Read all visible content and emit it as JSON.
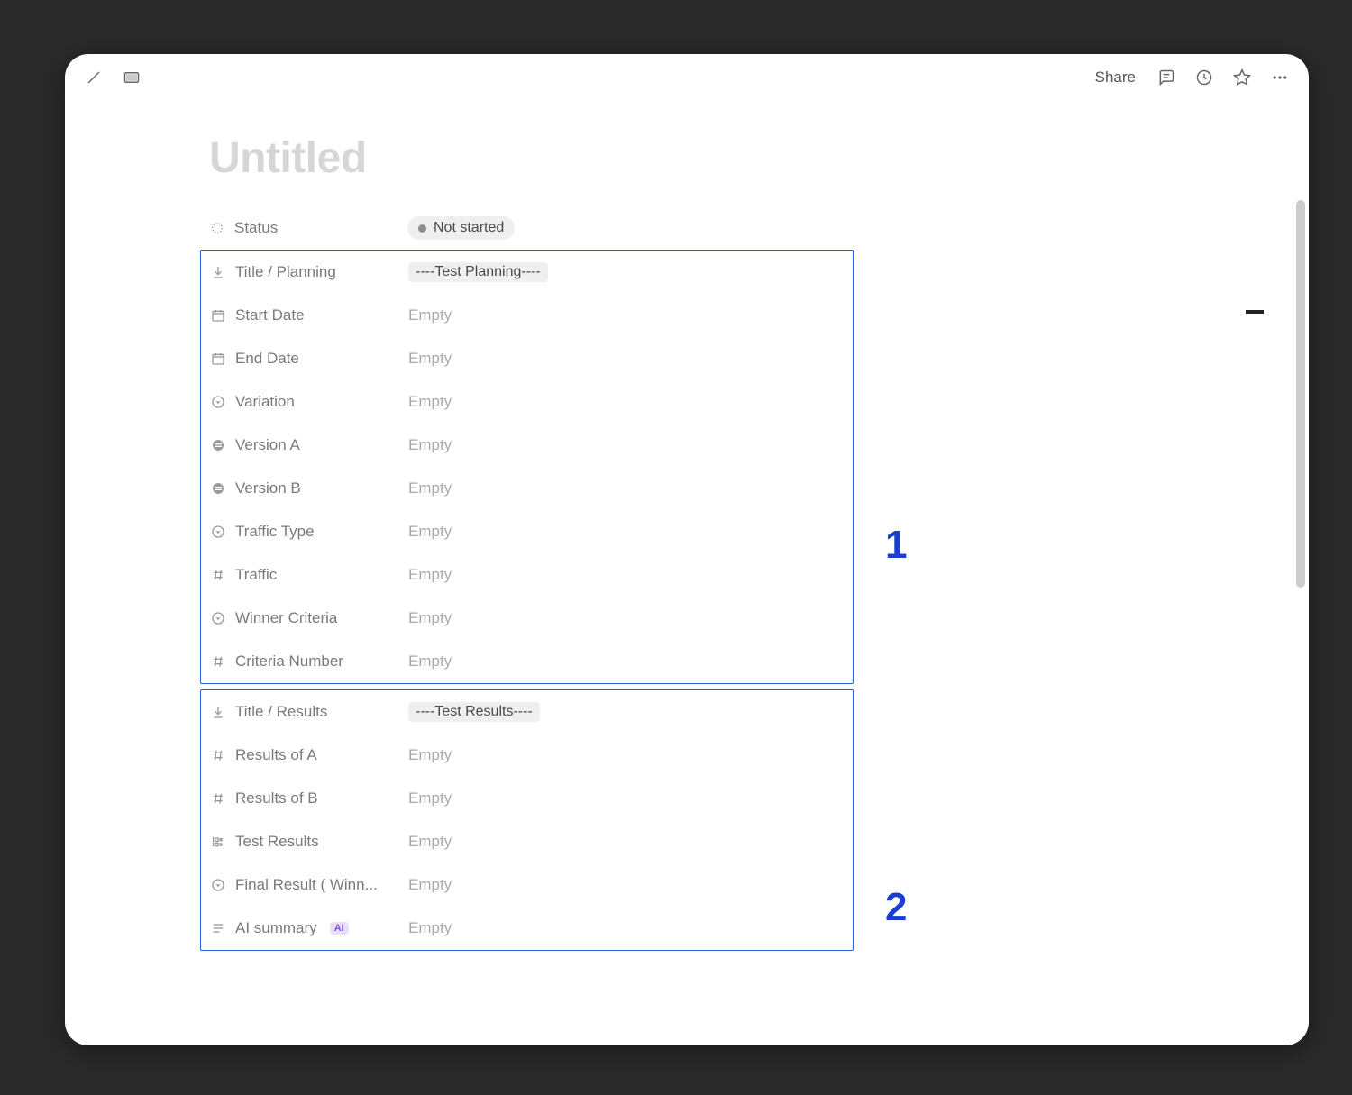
{
  "topbar": {
    "share_label": "Share"
  },
  "page": {
    "title_placeholder": "Untitled"
  },
  "annotations": {
    "group1_label": "1",
    "group2_label": "2"
  },
  "properties": {
    "status": {
      "label": "Status",
      "value": "Not started",
      "icon": "status"
    },
    "group1": [
      {
        "icon": "download",
        "label": "Title / Planning",
        "value_tag": "----Test Planning----"
      },
      {
        "icon": "date",
        "label": "Start Date",
        "value_empty": "Empty"
      },
      {
        "icon": "date",
        "label": "End Date",
        "value_empty": "Empty"
      },
      {
        "icon": "select",
        "label": "Variation",
        "value_empty": "Empty"
      },
      {
        "icon": "url",
        "label": "Version A",
        "value_empty": "Empty"
      },
      {
        "icon": "url",
        "label": "Version B",
        "value_empty": "Empty"
      },
      {
        "icon": "select",
        "label": "Traffic Type",
        "value_empty": "Empty"
      },
      {
        "icon": "number",
        "label": "Traffic",
        "value_empty": "Empty"
      },
      {
        "icon": "select",
        "label": "Winner Criteria",
        "value_empty": "Empty"
      },
      {
        "icon": "number",
        "label": "Criteria Number",
        "value_empty": "Empty"
      }
    ],
    "group2": [
      {
        "icon": "download",
        "label": "Title / Results",
        "value_tag": "----Test Results----"
      },
      {
        "icon": "number",
        "label": "Results of A",
        "value_empty": "Empty"
      },
      {
        "icon": "number",
        "label": "Results of B",
        "value_empty": "Empty"
      },
      {
        "icon": "formula",
        "label": "Test Results",
        "value_empty": "Empty"
      },
      {
        "icon": "select",
        "label": "Final Result ( Winn...",
        "value_empty": "Empty"
      },
      {
        "icon": "text",
        "label": "AI summary",
        "ai_badge": "AI",
        "value_empty": "Empty"
      }
    ]
  }
}
